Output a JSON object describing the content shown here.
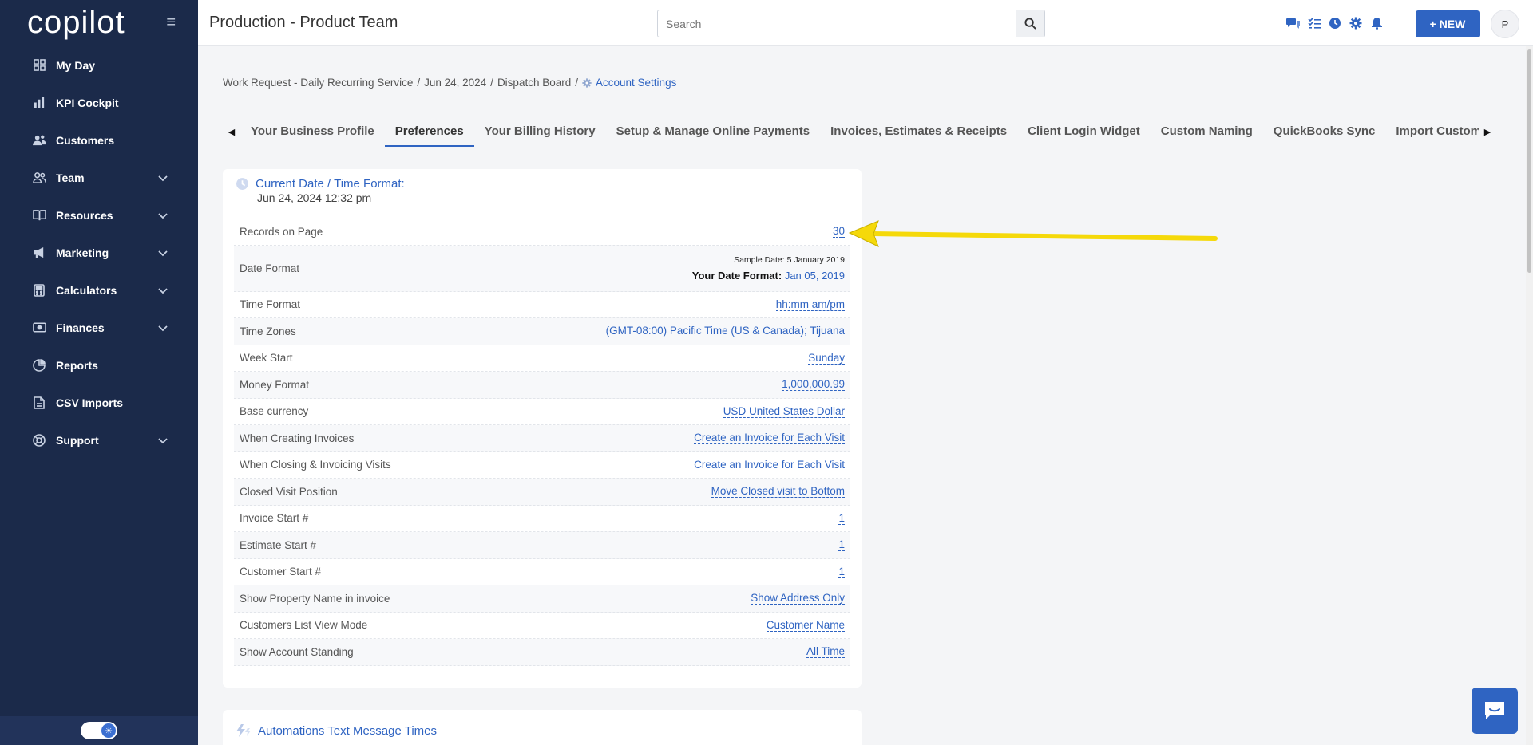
{
  "sidebar": {
    "logo_text": "copilot",
    "items": [
      {
        "label": "My Day",
        "icon": "grid-icon",
        "expandable": false
      },
      {
        "label": "KPI Cockpit",
        "icon": "bar-chart-icon",
        "expandable": false
      },
      {
        "label": "Customers",
        "icon": "users-icon",
        "expandable": false
      },
      {
        "label": "Team",
        "icon": "team-icon",
        "expandable": true
      },
      {
        "label": "Resources",
        "icon": "book-icon",
        "expandable": true
      },
      {
        "label": "Marketing",
        "icon": "megaphone-icon",
        "expandable": true
      },
      {
        "label": "Calculators",
        "icon": "calculator-icon",
        "expandable": true
      },
      {
        "label": "Finances",
        "icon": "money-icon",
        "expandable": true
      },
      {
        "label": "Reports",
        "icon": "pie-chart-icon",
        "expandable": false
      },
      {
        "label": "CSV Imports",
        "icon": "csv-file-icon",
        "expandable": false
      },
      {
        "label": "Support",
        "icon": "lifebuoy-icon",
        "expandable": true
      }
    ]
  },
  "header": {
    "title": "Production - Product Team",
    "search_placeholder": "Search",
    "new_label": "+ NEW",
    "avatar_initial": "P",
    "accent_color": "#2f64c2"
  },
  "breadcrumb": {
    "items": [
      "Work Request - Daily Recurring Service",
      "Jun 24, 2024",
      "Dispatch Board"
    ],
    "current": "Account Settings"
  },
  "tabs": [
    {
      "label": "Your Business Profile",
      "active": false
    },
    {
      "label": "Preferences",
      "active": true
    },
    {
      "label": "Your Billing History",
      "active": false
    },
    {
      "label": "Setup & Manage Online Payments",
      "active": false
    },
    {
      "label": "Invoices, Estimates & Receipts",
      "active": false
    },
    {
      "label": "Client Login Widget",
      "active": false
    },
    {
      "label": "Custom Naming",
      "active": false
    },
    {
      "label": "QuickBooks Sync",
      "active": false
    },
    {
      "label": "Import Customers, P",
      "active": false
    }
  ],
  "preferences": {
    "title": "Current Date / Time Format:",
    "current_datetime": "Jun 24, 2024 12:32 pm",
    "date_sample": "Sample Date: 5 January 2019",
    "date_yours_label": "Your Date Format:",
    "rows": [
      {
        "label": "Records on Page",
        "value": "30"
      },
      {
        "label": "Date Format",
        "value": "Jan 05, 2019"
      },
      {
        "label": "Time Format",
        "value": "hh:mm am/pm"
      },
      {
        "label": "Time Zones",
        "value": "(GMT-08:00) Pacific Time (US & Canada); Tijuana"
      },
      {
        "label": "Week Start",
        "value": "Sunday"
      },
      {
        "label": "Money Format",
        "value": "1,000,000.99"
      },
      {
        "label": "Base currency",
        "value": "USD United States Dollar"
      },
      {
        "label": "When Creating Invoices",
        "value": "Create an Invoice for Each Visit"
      },
      {
        "label": "When Closing & Invoicing Visits",
        "value": "Create an Invoice for Each Visit"
      },
      {
        "label": "Closed Visit Position",
        "value": "Move Closed visit to Bottom"
      },
      {
        "label": "Invoice Start #",
        "value": "1"
      },
      {
        "label": "Estimate Start #",
        "value": "1"
      },
      {
        "label": "Customer Start #",
        "value": "1"
      },
      {
        "label": "Show Property Name in invoice",
        "value": "Show Address Only"
      },
      {
        "label": "Customers List View Mode",
        "value": "Customer Name"
      },
      {
        "label": "Show Account Standing",
        "value": "All Time"
      }
    ]
  },
  "automations": {
    "title": "Automations Text Message Times"
  },
  "annotation_color": "#f5d90a"
}
